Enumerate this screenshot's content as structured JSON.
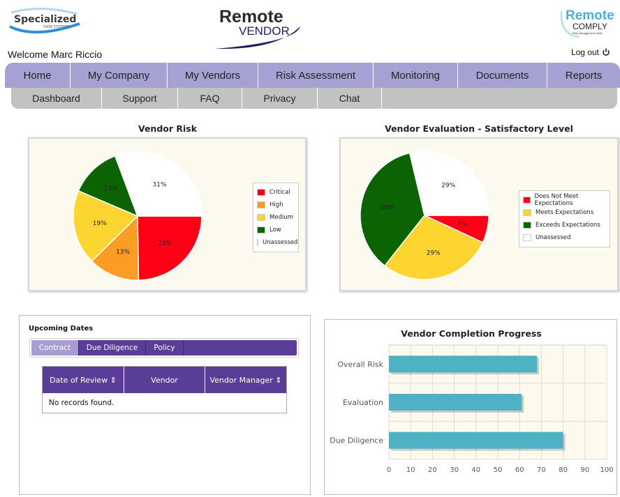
{
  "header": {
    "logo_left": {
      "line1": "Specialized",
      "line2": "DATA SYSTEMS"
    },
    "logo_center": {
      "line1": "Remote",
      "line2": "VENDOR"
    },
    "logo_right": {
      "line1": "Remote",
      "line2": "COMPLY",
      "line3": "Risk Management Suite"
    },
    "welcome": "Welcome Marc Riccio",
    "logout": "Log out"
  },
  "main_nav": [
    "Home",
    "My Company",
    "My Vendors",
    "Risk Assessment",
    "Monitoring",
    "Documents",
    "Reports"
  ],
  "sub_nav": [
    "Dashboard",
    "Support",
    "FAQ",
    "Privacy",
    "Chat"
  ],
  "colors": {
    "nav": "#a5a1d3",
    "subnav": "#c2c2c2",
    "purple": "#5a3d96",
    "critical": "#fe0016",
    "high": "#fb9c24",
    "medium": "#fcd530",
    "low": "#0b6304",
    "unassessed": "#ffffff",
    "bar": "#4eb1c4"
  },
  "upcoming": {
    "title": "Upcoming Dates",
    "tabs": [
      "Contract",
      "Due Diligence",
      "Policy"
    ],
    "active_tab": "Contract",
    "columns": [
      "Date of Review ⇕",
      "Vendor",
      "Vendor Manager ⇕"
    ],
    "empty_message": "No records found."
  },
  "chart_data": [
    {
      "type": "pie",
      "title": "Vendor Risk",
      "series": [
        {
          "name": "Critical",
          "value": 25,
          "label": "25%",
          "color": "#fe0016"
        },
        {
          "name": "High",
          "value": 13,
          "label": "13%",
          "color": "#fb9c24"
        },
        {
          "name": "Medium",
          "value": 19,
          "label": "19%",
          "color": "#fcd530"
        },
        {
          "name": "Low",
          "value": 13,
          "label": "13%",
          "color": "#0b6304"
        },
        {
          "name": "Unassessed",
          "value": 31,
          "label": "31%",
          "color": "#ffffff"
        }
      ],
      "legend": "right"
    },
    {
      "type": "pie",
      "title": "Vendor Evaluation - Satisfactory Level",
      "series": [
        {
          "name": "Does Not Meet Expectations",
          "value": 7,
          "label": "7%",
          "color": "#fe0016"
        },
        {
          "name": "Meets Expectations",
          "value": 29,
          "label": "29%",
          "color": "#fcd530"
        },
        {
          "name": "Exceeds Expectations",
          "value": 36,
          "label": "36%",
          "color": "#0b6304"
        },
        {
          "name": "Unassessed",
          "value": 29,
          "label": "29%",
          "color": "#ffffff"
        }
      ],
      "legend": "right"
    },
    {
      "type": "bar",
      "orientation": "horizontal",
      "title": "Vendor Completion Progress",
      "categories": [
        "Overall Risk",
        "Evaluation",
        "Due Diligence"
      ],
      "values": [
        68,
        61,
        80
      ],
      "xlim": [
        0,
        100
      ],
      "xticks": [
        "0",
        "10",
        "20",
        "30",
        "40",
        "50",
        "60",
        "70",
        "80",
        "90",
        "100"
      ],
      "grid": true
    }
  ]
}
